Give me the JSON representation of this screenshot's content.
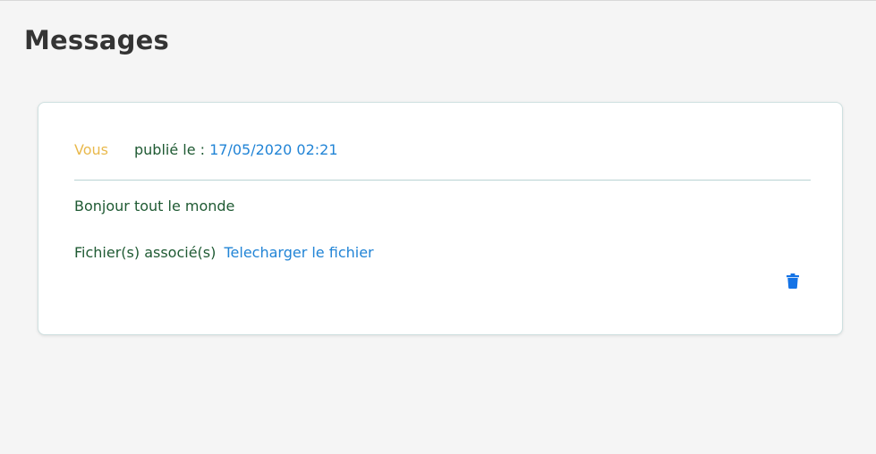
{
  "page": {
    "title": "Messages"
  },
  "message": {
    "author": "Vous",
    "posted_label": "publié le : ",
    "posted_date": "17/05/2020 02:21",
    "body": "Bonjour tout le monde",
    "attachments_label": "Fichier(s) associé(s)",
    "download_link": "Telecharger le fichier",
    "delete_icon": "trash-icon"
  },
  "colors": {
    "author": "#e9b94d",
    "text": "#1f5a33",
    "link": "#2184d6",
    "delete": "#1473e6"
  }
}
